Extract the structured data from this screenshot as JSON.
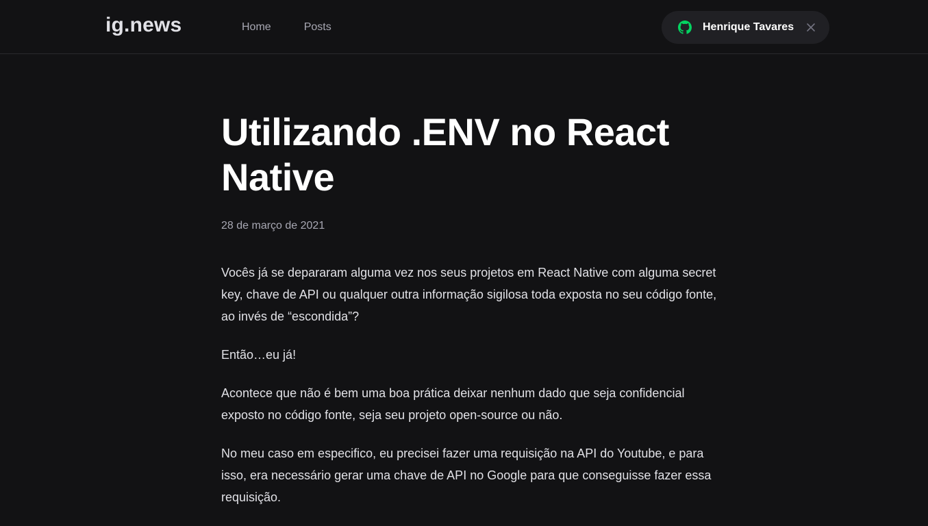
{
  "header": {
    "logo": "ig.news",
    "nav": [
      {
        "label": "Home"
      },
      {
        "label": "Posts"
      }
    ],
    "user": {
      "name": "Henrique Tavares",
      "icon": "github-icon",
      "icon_color": "#04d361",
      "close_icon": "close-icon"
    }
  },
  "post": {
    "title": "Utilizando .ENV no React Native",
    "date": "28 de março de 2021",
    "paragraphs": [
      "Vocês já se depararam alguma vez nos seus projetos em React Native com alguma secret key, chave de API ou qualquer outra informação sigilosa toda exposta no seu código fonte, ao invés de “escondida”?",
      "Então…eu já!",
      "Acontece que não é bem uma boa prática deixar nenhum dado que seja confidencial exposto no código fonte, seja seu projeto open-source ou não.",
      "No meu caso em especifico, eu precisei fazer uma requisição na API do Youtube, e para isso, era necessário gerar uma chave de API no Google para que conseguisse fazer essa requisição."
    ]
  },
  "colors": {
    "background": "#121214",
    "header_border": "#29292e",
    "pill_background": "#202024",
    "text": "#e1e1e6",
    "muted": "#a8a8b3",
    "accent": "#04d361"
  }
}
